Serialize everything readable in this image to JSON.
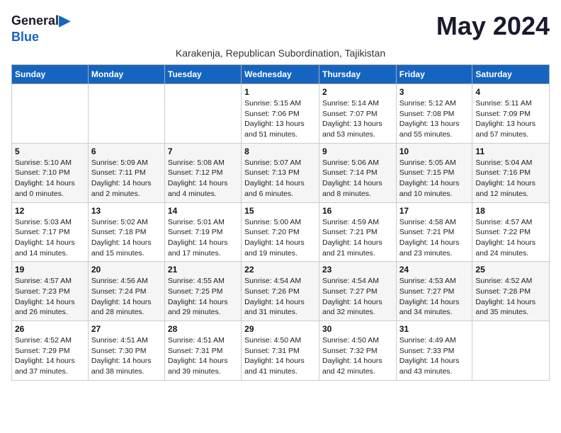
{
  "logo": {
    "general": "General",
    "blue": "Blue",
    "arrow": "▶"
  },
  "title": "May 2024",
  "subtitle": "Karakenja, Republican Subordination, Tajikistan",
  "weekdays": [
    "Sunday",
    "Monday",
    "Tuesday",
    "Wednesday",
    "Thursday",
    "Friday",
    "Saturday"
  ],
  "weeks": [
    [
      {
        "day": "",
        "sunrise": "",
        "sunset": "",
        "daylight": ""
      },
      {
        "day": "",
        "sunrise": "",
        "sunset": "",
        "daylight": ""
      },
      {
        "day": "",
        "sunrise": "",
        "sunset": "",
        "daylight": ""
      },
      {
        "day": "1",
        "sunrise": "Sunrise: 5:15 AM",
        "sunset": "Sunset: 7:06 PM",
        "daylight": "Daylight: 13 hours and 51 minutes."
      },
      {
        "day": "2",
        "sunrise": "Sunrise: 5:14 AM",
        "sunset": "Sunset: 7:07 PM",
        "daylight": "Daylight: 13 hours and 53 minutes."
      },
      {
        "day": "3",
        "sunrise": "Sunrise: 5:12 AM",
        "sunset": "Sunset: 7:08 PM",
        "daylight": "Daylight: 13 hours and 55 minutes."
      },
      {
        "day": "4",
        "sunrise": "Sunrise: 5:11 AM",
        "sunset": "Sunset: 7:09 PM",
        "daylight": "Daylight: 13 hours and 57 minutes."
      }
    ],
    [
      {
        "day": "5",
        "sunrise": "Sunrise: 5:10 AM",
        "sunset": "Sunset: 7:10 PM",
        "daylight": "Daylight: 14 hours and 0 minutes."
      },
      {
        "day": "6",
        "sunrise": "Sunrise: 5:09 AM",
        "sunset": "Sunset: 7:11 PM",
        "daylight": "Daylight: 14 hours and 2 minutes."
      },
      {
        "day": "7",
        "sunrise": "Sunrise: 5:08 AM",
        "sunset": "Sunset: 7:12 PM",
        "daylight": "Daylight: 14 hours and 4 minutes."
      },
      {
        "day": "8",
        "sunrise": "Sunrise: 5:07 AM",
        "sunset": "Sunset: 7:13 PM",
        "daylight": "Daylight: 14 hours and 6 minutes."
      },
      {
        "day": "9",
        "sunrise": "Sunrise: 5:06 AM",
        "sunset": "Sunset: 7:14 PM",
        "daylight": "Daylight: 14 hours and 8 minutes."
      },
      {
        "day": "10",
        "sunrise": "Sunrise: 5:05 AM",
        "sunset": "Sunset: 7:15 PM",
        "daylight": "Daylight: 14 hours and 10 minutes."
      },
      {
        "day": "11",
        "sunrise": "Sunrise: 5:04 AM",
        "sunset": "Sunset: 7:16 PM",
        "daylight": "Daylight: 14 hours and 12 minutes."
      }
    ],
    [
      {
        "day": "12",
        "sunrise": "Sunrise: 5:03 AM",
        "sunset": "Sunset: 7:17 PM",
        "daylight": "Daylight: 14 hours and 14 minutes."
      },
      {
        "day": "13",
        "sunrise": "Sunrise: 5:02 AM",
        "sunset": "Sunset: 7:18 PM",
        "daylight": "Daylight: 14 hours and 15 minutes."
      },
      {
        "day": "14",
        "sunrise": "Sunrise: 5:01 AM",
        "sunset": "Sunset: 7:19 PM",
        "daylight": "Daylight: 14 hours and 17 minutes."
      },
      {
        "day": "15",
        "sunrise": "Sunrise: 5:00 AM",
        "sunset": "Sunset: 7:20 PM",
        "daylight": "Daylight: 14 hours and 19 minutes."
      },
      {
        "day": "16",
        "sunrise": "Sunrise: 4:59 AM",
        "sunset": "Sunset: 7:21 PM",
        "daylight": "Daylight: 14 hours and 21 minutes."
      },
      {
        "day": "17",
        "sunrise": "Sunrise: 4:58 AM",
        "sunset": "Sunset: 7:21 PM",
        "daylight": "Daylight: 14 hours and 23 minutes."
      },
      {
        "day": "18",
        "sunrise": "Sunrise: 4:57 AM",
        "sunset": "Sunset: 7:22 PM",
        "daylight": "Daylight: 14 hours and 24 minutes."
      }
    ],
    [
      {
        "day": "19",
        "sunrise": "Sunrise: 4:57 AM",
        "sunset": "Sunset: 7:23 PM",
        "daylight": "Daylight: 14 hours and 26 minutes."
      },
      {
        "day": "20",
        "sunrise": "Sunrise: 4:56 AM",
        "sunset": "Sunset: 7:24 PM",
        "daylight": "Daylight: 14 hours and 28 minutes."
      },
      {
        "day": "21",
        "sunrise": "Sunrise: 4:55 AM",
        "sunset": "Sunset: 7:25 PM",
        "daylight": "Daylight: 14 hours and 29 minutes."
      },
      {
        "day": "22",
        "sunrise": "Sunrise: 4:54 AM",
        "sunset": "Sunset: 7:26 PM",
        "daylight": "Daylight: 14 hours and 31 minutes."
      },
      {
        "day": "23",
        "sunrise": "Sunrise: 4:54 AM",
        "sunset": "Sunset: 7:27 PM",
        "daylight": "Daylight: 14 hours and 32 minutes."
      },
      {
        "day": "24",
        "sunrise": "Sunrise: 4:53 AM",
        "sunset": "Sunset: 7:27 PM",
        "daylight": "Daylight: 14 hours and 34 minutes."
      },
      {
        "day": "25",
        "sunrise": "Sunrise: 4:52 AM",
        "sunset": "Sunset: 7:28 PM",
        "daylight": "Daylight: 14 hours and 35 minutes."
      }
    ],
    [
      {
        "day": "26",
        "sunrise": "Sunrise: 4:52 AM",
        "sunset": "Sunset: 7:29 PM",
        "daylight": "Daylight: 14 hours and 37 minutes."
      },
      {
        "day": "27",
        "sunrise": "Sunrise: 4:51 AM",
        "sunset": "Sunset: 7:30 PM",
        "daylight": "Daylight: 14 hours and 38 minutes."
      },
      {
        "day": "28",
        "sunrise": "Sunrise: 4:51 AM",
        "sunset": "Sunset: 7:31 PM",
        "daylight": "Daylight: 14 hours and 39 minutes."
      },
      {
        "day": "29",
        "sunrise": "Sunrise: 4:50 AM",
        "sunset": "Sunset: 7:31 PM",
        "daylight": "Daylight: 14 hours and 41 minutes."
      },
      {
        "day": "30",
        "sunrise": "Sunrise: 4:50 AM",
        "sunset": "Sunset: 7:32 PM",
        "daylight": "Daylight: 14 hours and 42 minutes."
      },
      {
        "day": "31",
        "sunrise": "Sunrise: 4:49 AM",
        "sunset": "Sunset: 7:33 PM",
        "daylight": "Daylight: 14 hours and 43 minutes."
      },
      {
        "day": "",
        "sunrise": "",
        "sunset": "",
        "daylight": ""
      }
    ]
  ]
}
